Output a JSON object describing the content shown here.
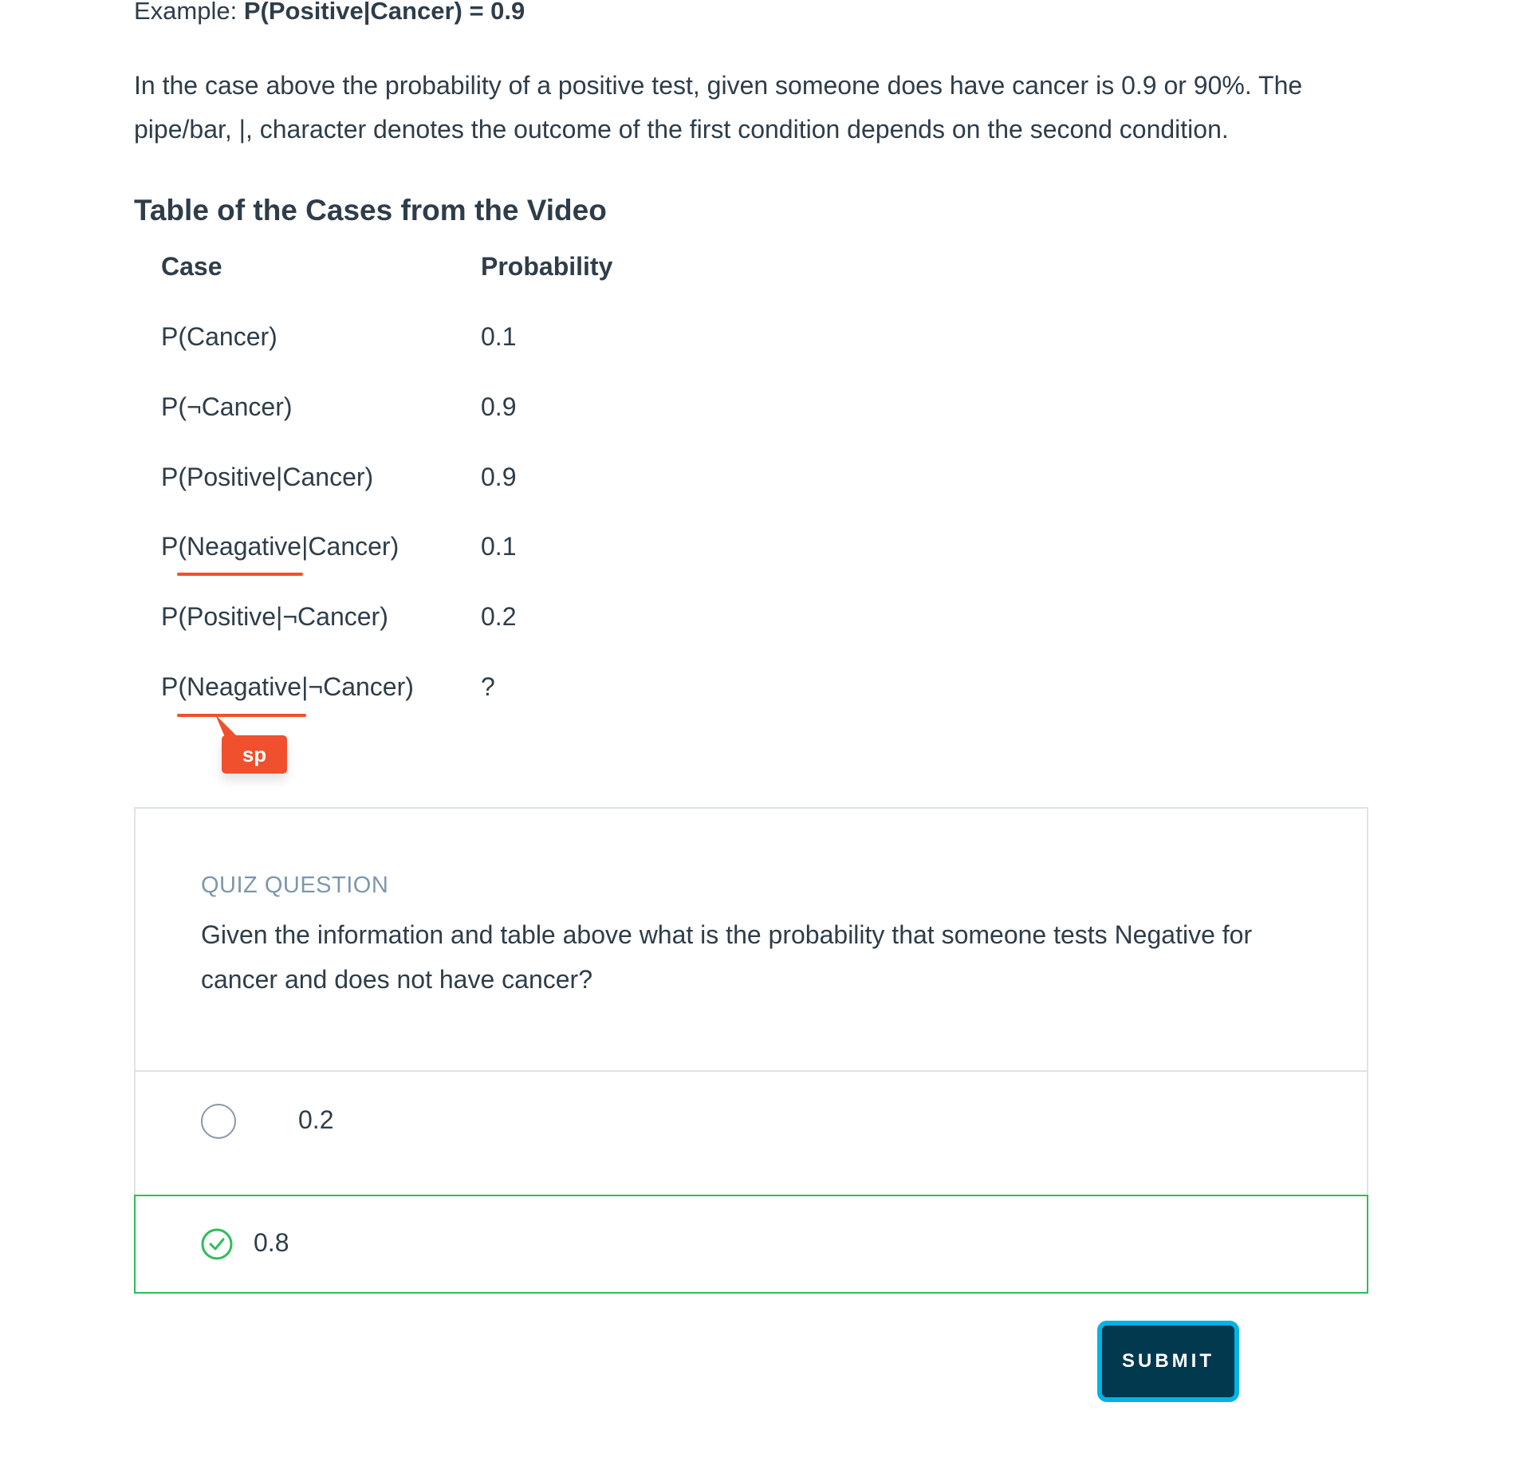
{
  "example": {
    "prefix": "Example: ",
    "formula": "P(Positive|Cancer) = 0.9"
  },
  "paragraph": "In the case above the probability of a positive test, given someone does have cancer is 0.9 or 90%. The pipe/bar, |, character denotes the outcome of the first condition depends on the second condition.",
  "section_title": "Table of the Cases from the Video",
  "table": {
    "headers": [
      "Case",
      "Probability"
    ],
    "rows": [
      {
        "case": "P(Cancer)",
        "probability": "0.1"
      },
      {
        "case": "P(¬Cancer)",
        "probability": "0.9"
      },
      {
        "case": "P(Positive|Cancer)",
        "probability": "0.9"
      },
      {
        "case": "P(Neagative|Cancer)",
        "probability": "0.1"
      },
      {
        "case": "P(Positive|¬Cancer)",
        "probability": "0.2"
      },
      {
        "case": "P(Neagative|¬Cancer)",
        "probability": "?"
      }
    ]
  },
  "spell_badge": "sp",
  "annotation_color": "#f0502d",
  "quiz": {
    "label": "QUIZ QUESTION",
    "question": "Given the information and table above what is the probability that someone tests Negative for cancer and does not have cancer?",
    "options": [
      {
        "label": "0.2",
        "selected": false
      },
      {
        "label": "0.8",
        "selected": true
      }
    ],
    "correct_color": "#2ebd59"
  },
  "submit_label": "SUBMIT",
  "colors": {
    "text": "#2e3d49",
    "muted": "#7d97ad",
    "submit_bg": "#02394e",
    "submit_border": "#02b3e4"
  }
}
